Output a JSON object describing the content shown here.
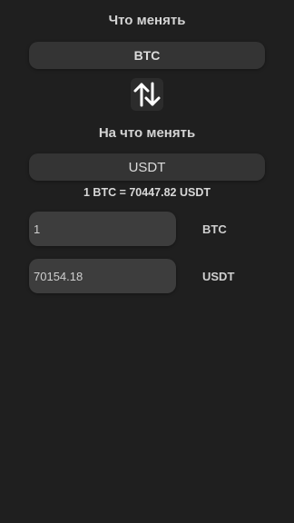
{
  "from_label": "Что менять",
  "to_label": "На что менять",
  "from_currency": "BTC",
  "to_currency": "USDT",
  "rate_text": "1 BTC = 70447.82 USDT",
  "amount_from": "1",
  "amount_to": "70154.18",
  "icons": {
    "swap": "swap-vertical-icon"
  }
}
